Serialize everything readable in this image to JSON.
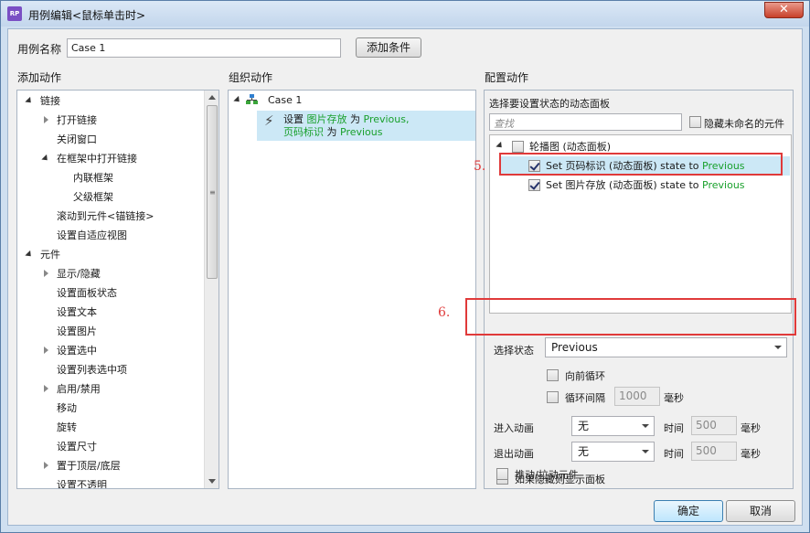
{
  "window": {
    "title": "用例编辑<鼠标单击时>",
    "app_icon": "RP"
  },
  "case_name": {
    "label": "用例名称",
    "value": "Case 1",
    "add_condition": "添加条件"
  },
  "add_actions": {
    "title": "添加动作",
    "items": [
      {
        "label": "链接"
      },
      {
        "label": "打开链接"
      },
      {
        "label": "关闭窗口"
      },
      {
        "label": "在框架中打开链接"
      },
      {
        "label": "内联框架"
      },
      {
        "label": "父级框架"
      },
      {
        "label": "滚动到元件<锚链接>"
      },
      {
        "label": "设置自适应视图"
      },
      {
        "label": "元件"
      },
      {
        "label": "显示/隐藏"
      },
      {
        "label": "设置面板状态"
      },
      {
        "label": "设置文本"
      },
      {
        "label": "设置图片"
      },
      {
        "label": "设置选中"
      },
      {
        "label": "设置列表选中项"
      },
      {
        "label": "启用/禁用"
      },
      {
        "label": "移动"
      },
      {
        "label": "旋转"
      },
      {
        "label": "设置尺寸"
      },
      {
        "label": "置于顶层/底层"
      },
      {
        "label": "设置不透明"
      }
    ]
  },
  "organize_actions": {
    "title": "组织动作",
    "case_label": "Case 1",
    "action": {
      "prefix": "设置",
      "target1": "图片存放",
      "mid1": "为",
      "value1": "Previous,",
      "target2": "页码标识",
      "mid2": "为",
      "value2": "Previous"
    }
  },
  "configure_actions": {
    "title": "配置动作",
    "subtitle": "选择要设置状态的动态面板",
    "search_placeholder": "查找",
    "hide_unnamed": "隐藏未命名的元件",
    "tree": {
      "root": "轮播图 (动态面板)",
      "item1": {
        "prefix": "Set 页码标识 (动态面板) state to",
        "value": "Previous"
      },
      "item2": {
        "prefix": "Set 图片存放 (动态面板) state to",
        "value": "Previous"
      }
    },
    "select_state": {
      "label": "选择状态",
      "value": "Previous"
    },
    "loop_forward": "向前循环",
    "loop_interval": {
      "label": "循环间隔",
      "value": "1000",
      "unit": "毫秒"
    },
    "enter_anim": {
      "label": "进入动画",
      "value": "无",
      "time_label": "时间",
      "time_value": "500",
      "unit": "毫秒"
    },
    "exit_anim": {
      "label": "退出动画",
      "value": "无",
      "time_label": "时间",
      "time_value": "500",
      "unit": "毫秒"
    },
    "show_if_hidden": "如果隐藏则显示面板",
    "push_pull": "推动/拉动元件"
  },
  "annotations": {
    "num5": "5.",
    "num6": "6."
  },
  "buttons": {
    "ok": "确定",
    "cancel": "取消"
  },
  "colors": {
    "accent_green": "#19a02c",
    "highlight": "#cce8f6",
    "annotation_red": "#e03a3a"
  }
}
